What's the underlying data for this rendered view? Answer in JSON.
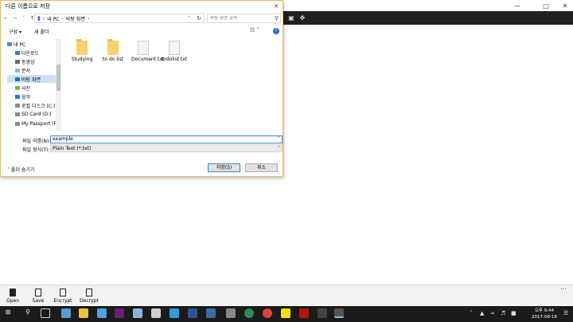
{
  "dialog": {
    "title": "다른 이름으로 저장",
    "address": {
      "root": "내 PC",
      "folder": "바탕 화면"
    },
    "search_placeholder": "바탕 화면 검색",
    "cmd_organize": "구성 ▾",
    "cmd_new_folder": "새 폴더",
    "nav": [
      {
        "label": "내 PC",
        "icon": "computer-icon"
      },
      {
        "label": "다운로드",
        "icon": "download-icon"
      },
      {
        "label": "동영상",
        "icon": "video-icon"
      },
      {
        "label": "문서",
        "icon": "document-icon"
      },
      {
        "label": "바탕 화면",
        "icon": "desktop-icon",
        "selected": true
      },
      {
        "label": "사진",
        "icon": "picture-icon"
      },
      {
        "label": "음악",
        "icon": "music-icon"
      },
      {
        "label": "로컬 디스크 (C:)",
        "icon": "disk-icon"
      },
      {
        "label": "SD Card (D:)",
        "icon": "sd-card-icon"
      },
      {
        "label": "My Passport (F:)",
        "icon": "drive-icon"
      }
    ],
    "files": [
      {
        "name": "Studying",
        "type": "folder"
      },
      {
        "name": "to do list",
        "type": "folder"
      },
      {
        "name": "Document.txt",
        "type": "doc"
      },
      {
        "name": "todolist.txt",
        "type": "doc"
      }
    ],
    "filename_label": "파일 이름(N):",
    "filename_value": "example",
    "filetype_label": "파일 형식(T):",
    "filetype_value": "Plain Text (*.txt)",
    "hide_folders": "폴더 숨기기",
    "save_button": "저장(S)",
    "cancel_button": "취소"
  },
  "app_commands": [
    {
      "label": "Open",
      "icon": "open-icon"
    },
    {
      "label": "Save",
      "icon": "save-icon"
    },
    {
      "label": "Encrypt",
      "icon": "encrypt-icon"
    },
    {
      "label": "Decrypt",
      "icon": "decrypt-icon"
    }
  ],
  "taskbar": {
    "time": "오후 9:44",
    "date": "2017-08-16"
  }
}
